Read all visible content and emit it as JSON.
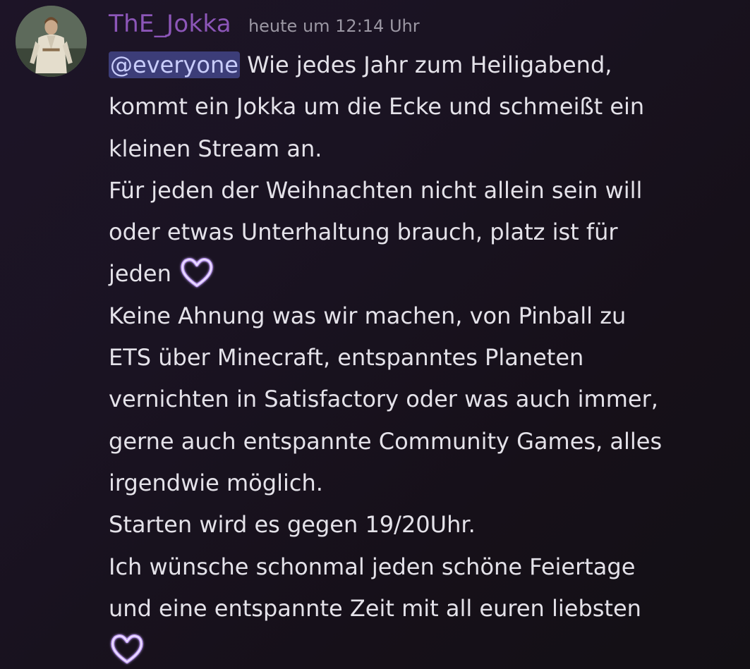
{
  "message": {
    "author": "ThE_Jokka",
    "timestamp": "heute um 12:14 Uhr",
    "mention": "@everyone",
    "lines": [
      " Wie jedes Jahr zum Heiligabend,",
      "kommt ein Jokka um die Ecke und schmeißt ein",
      "kleinen Stream an.",
      "Für jeden der Weihnachten nicht allein sein will",
      "oder etwas Unterhaltung brauch, platz ist für",
      "jeden ",
      "Keine Ahnung was wir machen, von Pinball zu",
      "ETS über Minecraft, entspanntes Planeten",
      "vernichten in Satisfactory oder was auch immer,",
      "gerne auch entspannte Community Games, alles",
      "irgendwie möglich.",
      "Starten wird es gegen 19/20Uhr.",
      "Ich wünsche schonmal jeden schöne Feiertage",
      "und eine entspannte Zeit mit all euren liebsten"
    ],
    "emoji_icon": "purple-heart-icon"
  },
  "colors": {
    "username": "#8c56b8",
    "mention_bg": "#3c3d78",
    "mention_text": "#c9cdfb",
    "heart": "#c9a6ff"
  }
}
